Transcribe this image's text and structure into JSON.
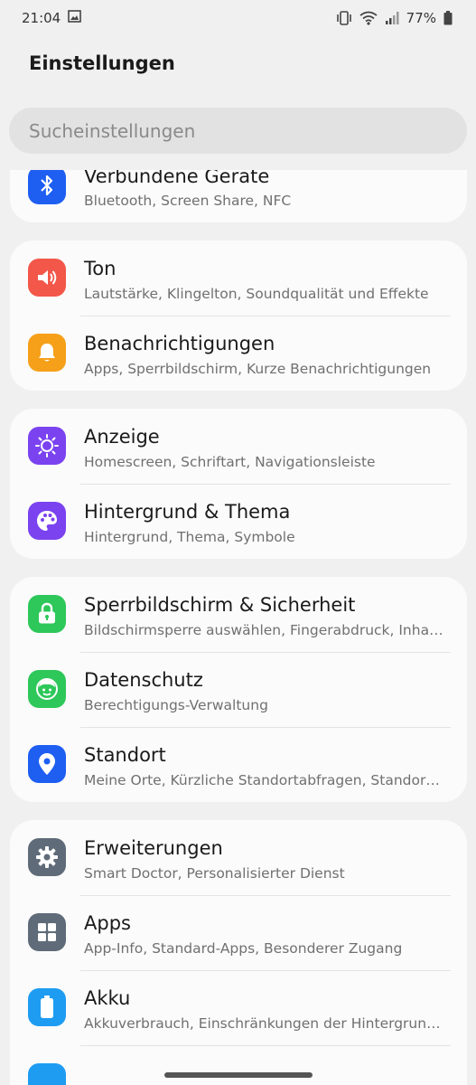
{
  "status_bar": {
    "time": "21:04",
    "battery": "77%"
  },
  "page_title": "Einstellungen",
  "search": {
    "placeholder": "Sucheinstellungen"
  },
  "cards": [
    {
      "items": [
        {
          "title": "Verbundene Geräte",
          "subtitle": "Bluetooth, Screen Share, NFC",
          "icon": "bluetooth-icon",
          "color": "#1e5ff2"
        }
      ]
    },
    {
      "items": [
        {
          "title": "Ton",
          "subtitle": "Lautstärke, Klingelton, Soundqualität und Effekte",
          "icon": "speaker-icon",
          "color": "#f2574a"
        },
        {
          "title": "Benachrichtigungen",
          "subtitle": "Apps, Sperrbildschirm, Kurze Benachrichtigungen",
          "icon": "bell-icon",
          "color": "#f6a01a"
        }
      ]
    },
    {
      "items": [
        {
          "title": "Anzeige",
          "subtitle": "Homescreen, Schriftart, Navigationsleiste",
          "icon": "sun-icon",
          "color": "#7b42f0"
        },
        {
          "title": "Hintergrund & Thema",
          "subtitle": "Hintergrund, Thema, Symbole",
          "icon": "palette-icon",
          "color": "#7b42f0"
        }
      ]
    },
    {
      "items": [
        {
          "title": "Sperrbildschirm & Sicherheit",
          "subtitle": "Bildschirmsperre auswählen, Fingerabdruck, Inhalte",
          "icon": "lock-icon",
          "color": "#2ec75a"
        },
        {
          "title": "Datenschutz",
          "subtitle": "Berechtigungs-Verwaltung",
          "icon": "privacy-icon",
          "color": "#2ec75a"
        },
        {
          "title": "Standort",
          "subtitle": "Meine Orte, Kürzliche Standortabfragen, Standortdienste",
          "icon": "location-pin-icon",
          "color": "#1e5ff2"
        }
      ]
    },
    {
      "items": [
        {
          "title": "Erweiterungen",
          "subtitle": "Smart Doctor, Personalisierter Dienst",
          "icon": "gear-icon",
          "color": "#5f6b78"
        },
        {
          "title": "Apps",
          "subtitle": "App-Info, Standard-Apps, Besonderer Zugang",
          "icon": "apps-grid-icon",
          "color": "#5f6b78"
        },
        {
          "title": "Akku",
          "subtitle": "Akkuverbrauch, Einschränkungen der Hintergrundnutzung",
          "icon": "battery-icon",
          "color": "#1e9cf2"
        }
      ]
    }
  ]
}
